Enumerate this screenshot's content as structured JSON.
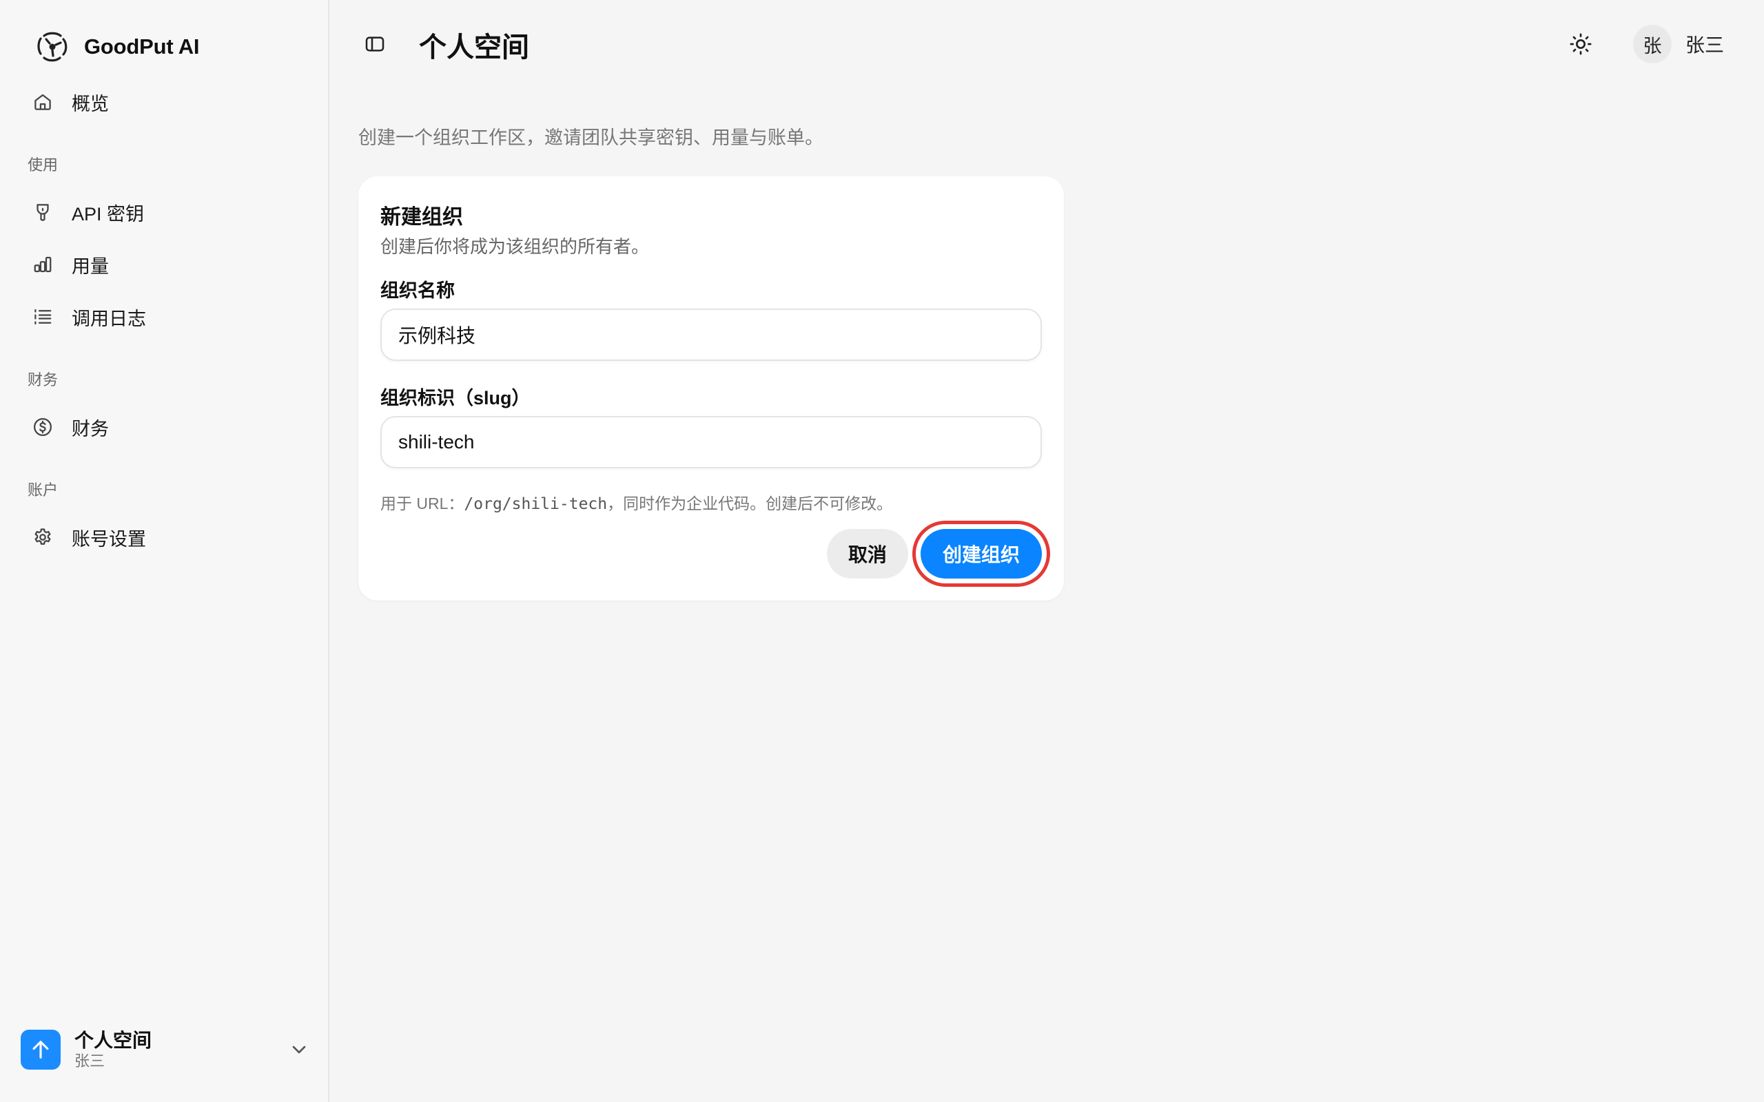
{
  "brand": {
    "name": "GoodPut AI"
  },
  "sidebar": {
    "overview": {
      "label": "概览",
      "icon": "home-icon"
    },
    "sections": [
      {
        "title": "使用",
        "items": [
          {
            "label": "API 密钥",
            "icon": "key-icon"
          },
          {
            "label": "用量",
            "icon": "bar-chart-icon"
          },
          {
            "label": "调用日志",
            "icon": "list-icon"
          }
        ]
      },
      {
        "title": "财务",
        "items": [
          {
            "label": "财务",
            "icon": "dollar-circle-icon"
          }
        ]
      },
      {
        "title": "账户",
        "items": [
          {
            "label": "账号设置",
            "icon": "gear-icon"
          }
        ]
      }
    ],
    "workspace": {
      "title": "个人空间",
      "subtitle": "张三"
    }
  },
  "header": {
    "title": "个人空间",
    "user": {
      "avatar_initial": "张",
      "name": "张三"
    }
  },
  "main": {
    "intro": "创建一个组织工作区，邀请团队共享密钥、用量与账单。",
    "card": {
      "title": "新建组织",
      "subtitle": "创建后你将成为该组织的所有者。",
      "name_label": "组织名称",
      "name_value": "示例科技",
      "slug_label": "组织标识（slug）",
      "slug_value": "shili-tech",
      "hint_prefix": "用于 URL：",
      "hint_path": "/org/shili-tech",
      "hint_suffix": "，同时作为企业代码。创建后不可修改。",
      "cancel_label": "取消",
      "submit_label": "创建组织"
    }
  },
  "colors": {
    "accent": "#0a84ff",
    "highlight": "#e53935",
    "workspace_badge": "#1a8cff"
  }
}
